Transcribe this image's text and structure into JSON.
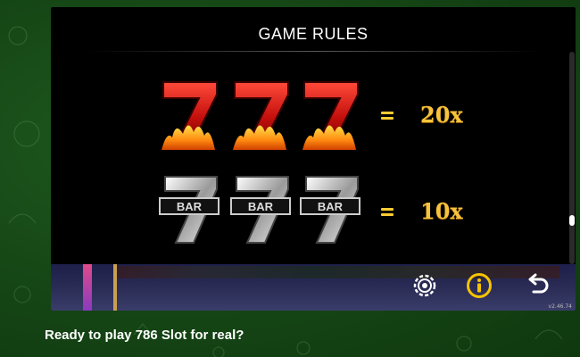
{
  "rules": {
    "title": "GAME RULES",
    "paytable": [
      {
        "symbol": "red-seven-flame",
        "count": 3,
        "payout": "20x"
      },
      {
        "symbol": "silver-bar-seven",
        "count": 3,
        "payout": "10x",
        "symbol_text": "BAR"
      }
    ]
  },
  "controls": {
    "settings_icon": "gear-icon",
    "info_icon": "info-icon",
    "back_icon": "back-arrow-icon"
  },
  "version": "v2.46.74",
  "cta": {
    "text": "Ready to play 786 Slot for real?"
  },
  "colors": {
    "background": "#154515",
    "panel": "#000000",
    "payout": "#f7c33c",
    "info_accent": "#f5c400"
  }
}
